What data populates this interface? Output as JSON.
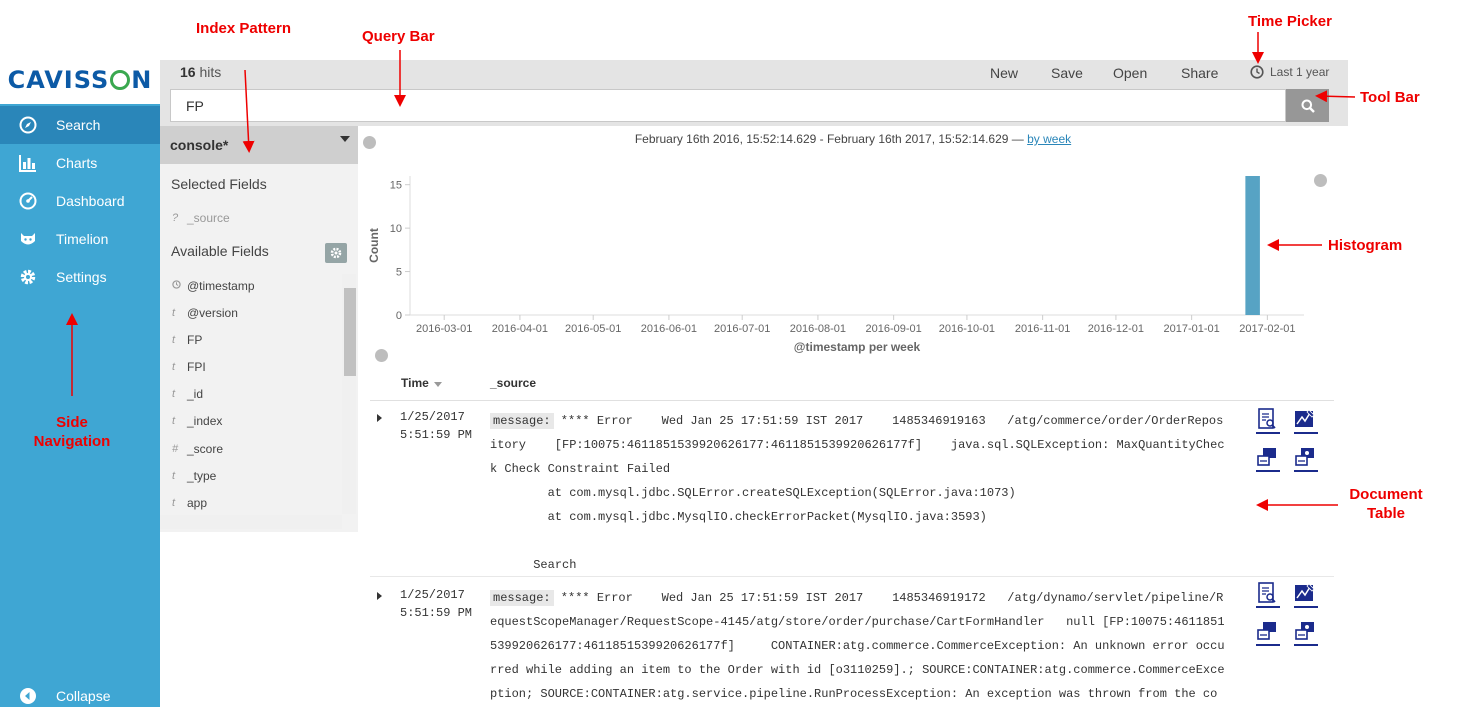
{
  "brand": {
    "logo_text": "CAVISSON"
  },
  "sidebar": {
    "items": [
      {
        "label": "Search",
        "icon": "compass-icon",
        "active": true
      },
      {
        "label": "Charts",
        "icon": "bar-chart-icon",
        "active": false
      },
      {
        "label": "Dashboard",
        "icon": "dashboard-icon",
        "active": false
      },
      {
        "label": "Timelion",
        "icon": "timelion-icon",
        "active": false
      },
      {
        "label": "Settings",
        "icon": "gear-icon",
        "active": false
      }
    ],
    "collapse_label": "Collapse"
  },
  "toolbar": {
    "hits_count": "16",
    "hits_label": "hits",
    "new_label": "New",
    "save_label": "Save",
    "open_label": "Open",
    "share_label": "Share",
    "time_picker_label": "Last 1 year"
  },
  "query": {
    "value": "FP"
  },
  "index_pattern": "console*",
  "fields": {
    "selected_heading": "Selected Fields",
    "selected": [
      {
        "type": "?",
        "name": "_source"
      }
    ],
    "available_heading": "Available Fields",
    "available": [
      {
        "type": "clock",
        "name": "@timestamp"
      },
      {
        "type": "t",
        "name": "@version"
      },
      {
        "type": "t",
        "name": "FP"
      },
      {
        "type": "t",
        "name": "FPI"
      },
      {
        "type": "t",
        "name": "_id"
      },
      {
        "type": "t",
        "name": "_index"
      },
      {
        "type": "#",
        "name": "_score"
      },
      {
        "type": "t",
        "name": "_type"
      },
      {
        "type": "t",
        "name": "app"
      }
    ]
  },
  "histogram": {
    "range_text": "February 16th 2016, 15:52:14.629 - February 16th 2017, 15:52:14.629 —",
    "interval_link": "by week"
  },
  "chart_data": {
    "type": "bar",
    "xlabel": "@timestamp per week",
    "ylabel": "Count",
    "ylim": [
      0,
      16
    ],
    "yticks": [
      0,
      5,
      10,
      15
    ],
    "x_tick_labels": [
      "2016-03-01",
      "2016-04-01",
      "2016-05-01",
      "2016-06-01",
      "2016-07-01",
      "2016-08-01",
      "2016-09-01",
      "2016-10-01",
      "2016-11-01",
      "2016-12-01",
      "2017-01-01",
      "2017-02-01"
    ],
    "bars": [
      {
        "x": "2017-01-23",
        "value": 16
      }
    ],
    "bar_color": "#57a3c4",
    "grid": false
  },
  "table": {
    "columns": [
      "Time",
      "_source"
    ],
    "rows": [
      {
        "date": "1/25/2017",
        "time": "5:51:59 PM",
        "message_key": "message:",
        "source_text": " **** Error    Wed Jan 25 17:51:59 IST 2017    1485346919163   /atg/commerce/order/OrderRepository    [FP:10075:4611851539920626177:4611851539920626177f]    java.sql.SQLException: MaxQuantityCheck Check Constraint Failed\n        at com.mysql.jdbc.SQLError.createSQLException(SQLError.java:1073)\n        at com.mysql.jdbc.MysqlIO.checkErrorPacket(MysqlIO.java:3593)\n\n      Search"
      },
      {
        "date": "1/25/2017",
        "time": "5:51:59 PM",
        "message_key": "message:",
        "source_text": " **** Error    Wed Jan 25 17:51:59 IST 2017    1485346919172   /atg/dynamo/servlet/pipeline/RequestScopeManager/RequestScope-4145/atg/store/order/purchase/CartFormHandler   null [FP:10075:4611851539920626177:4611851539920626177f]     CONTAINER:atg.commerce.CommerceException: An unknown error occurred while adding an item to the Order with id [o3110259].; SOURCE:CONTAINER:atg.commerce.CommerceException; SOURCE:CONTAINER:atg.service.pipeline.RunProcessException: An exception was thrown from the co"
      }
    ]
  },
  "annotations": {
    "index_pattern": "Index Pattern",
    "query_bar": "Query Bar",
    "time_picker": "Time Picker",
    "tool_bar": "Tool Bar",
    "histogram": "Histogram",
    "side_navigation": "Side\nNavigation",
    "document_table": "Document\nTable",
    "color": "#e00000"
  }
}
